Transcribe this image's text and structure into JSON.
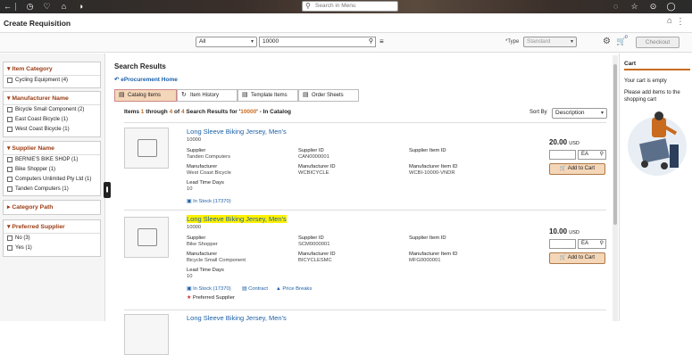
{
  "app": {
    "search_menu_placeholder": "Search in Menu",
    "page_title": "Create Requisition"
  },
  "search": {
    "scope": "All",
    "keyword": "10000",
    "type_label": "*Type",
    "type_value": "Standard",
    "cart_count": "0",
    "checkout_label": "Checkout"
  },
  "facets": {
    "item_category": {
      "title": "Item Category",
      "items": [
        "Cycling Equipment (4)"
      ]
    },
    "manufacturer": {
      "title": "Manufacturer Name",
      "items": [
        "Bicycle Small Component (2)",
        "East Coast Bicycle (1)",
        "West Coast Bicycle (1)"
      ]
    },
    "supplier": {
      "title": "Supplier Name",
      "items": [
        "BERNIE'S BIKE SHOP (1)",
        "Bike Shopper (1)",
        "Computers Unlimited Pty Ltd (1)",
        "Tanden Computers (1)"
      ]
    },
    "category_path": {
      "title": "Category Path"
    },
    "preferred": {
      "title": "Preferred Supplier",
      "items": [
        "No (3)",
        "Yes (1)"
      ]
    }
  },
  "results": {
    "heading": "Search Results",
    "eprocurement_home": "eProcurement Home",
    "tabs": [
      "Catalog Items",
      "Item History",
      "Template Items",
      "Order Sheets"
    ],
    "summary": {
      "p1": "Items ",
      "a": "1",
      "p2": " through ",
      "b": "4",
      "p3": " of ",
      "c": "4",
      "p4": " Search Results for '",
      "term": "10000",
      "p5": "' - In Catalog"
    },
    "sort_label": "Sort By",
    "sort_value": "Description",
    "labels": {
      "supplier": "Supplier",
      "supplier_id": "Supplier ID",
      "supplier_item_id": "Supplier Item ID",
      "manufacturer": "Manufacturer",
      "manufacturer_id": "Manufacturer ID",
      "manufacturer_item_id": "Manufacturer Item ID",
      "lead_time": "Lead Time Days",
      "add_to_cart": "Add to Cart",
      "currency": "USD",
      "uom": "EA"
    },
    "items": [
      {
        "name": "Long Sleeve Biking Jersey, Men's",
        "id": "10000",
        "supplier": "Tanden Computers",
        "supplier_id": "CAN0000001",
        "supplier_item_id": "",
        "manufacturer": "West Coast Bicycle",
        "manufacturer_id": "WCBICYCLE",
        "manufacturer_item_id": "WCBI-10000-VNDR",
        "lead_time": "10",
        "price": "20.00",
        "stock": "In Stock (17370)"
      },
      {
        "name": "Long Sleeve Biking Jersey, Men's",
        "id": "10000",
        "supplier": "Bike Shopper",
        "supplier_id": "SCM0000001",
        "supplier_item_id": "",
        "manufacturer": "Bicycle Small Component",
        "manufacturer_id": "BICYCLESMC",
        "manufacturer_item_id": "MFG0000001",
        "lead_time": "10",
        "price": "10.00",
        "stock": "In Stock (17370)",
        "contract": "Contract",
        "price_breaks": "Price Breaks",
        "preferred": "Preferred Supplier"
      },
      {
        "name": "Long Sleeve Biking Jersey, Men's"
      }
    ]
  },
  "cart": {
    "title": "Cart",
    "empty": "Your cart is empty",
    "hint": "Please add items to the shopping cart"
  },
  "colors": {
    "accent": "#c86b1f",
    "link": "#1b5fa8",
    "button": "#f4d6b8",
    "highlight": "#fff200"
  }
}
